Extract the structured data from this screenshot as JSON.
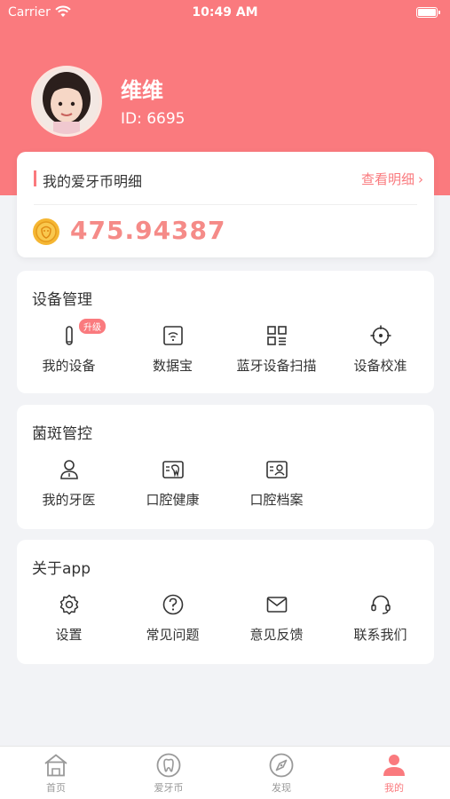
{
  "status_bar": {
    "carrier": "Carrier",
    "time": "10:49 AM"
  },
  "profile": {
    "name": "维维",
    "id": "ID: 6695"
  },
  "coin_card": {
    "title": "我的爱牙币明细",
    "detail_link": "查看明细",
    "amount": "475.94387"
  },
  "device_section": {
    "title": "设备管理",
    "items": [
      {
        "label": "我的设备",
        "icon": "toothbrush-icon",
        "badge": "升级"
      },
      {
        "label": "数据宝",
        "icon": "wifi-box-icon"
      },
      {
        "label": "蓝牙设备扫描",
        "icon": "qr-scan-icon"
      },
      {
        "label": "设备校准",
        "icon": "crosshair-icon"
      }
    ]
  },
  "plaque_section": {
    "title": "菌斑管控",
    "items": [
      {
        "label": "我的牙医",
        "icon": "dentist-icon"
      },
      {
        "label": "口腔健康",
        "icon": "oral-health-icon"
      },
      {
        "label": "口腔档案",
        "icon": "oral-record-icon"
      }
    ]
  },
  "about_section": {
    "title": "关于app",
    "items": [
      {
        "label": "设置",
        "icon": "gear-icon"
      },
      {
        "label": "常见问题",
        "icon": "question-icon"
      },
      {
        "label": "意见反馈",
        "icon": "mail-icon"
      },
      {
        "label": "联系我们",
        "icon": "headset-icon"
      }
    ]
  },
  "tabbar": {
    "tabs": [
      {
        "label": "首页",
        "icon": "home-icon"
      },
      {
        "label": "爱牙币",
        "icon": "tooth-coin-icon"
      },
      {
        "label": "发现",
        "icon": "compass-icon"
      },
      {
        "label": "我的",
        "icon": "person-icon",
        "active": true
      }
    ]
  },
  "colors": {
    "brand": "#fa7a7e",
    "amount": "#f58b88",
    "background": "#f2f3f6"
  }
}
